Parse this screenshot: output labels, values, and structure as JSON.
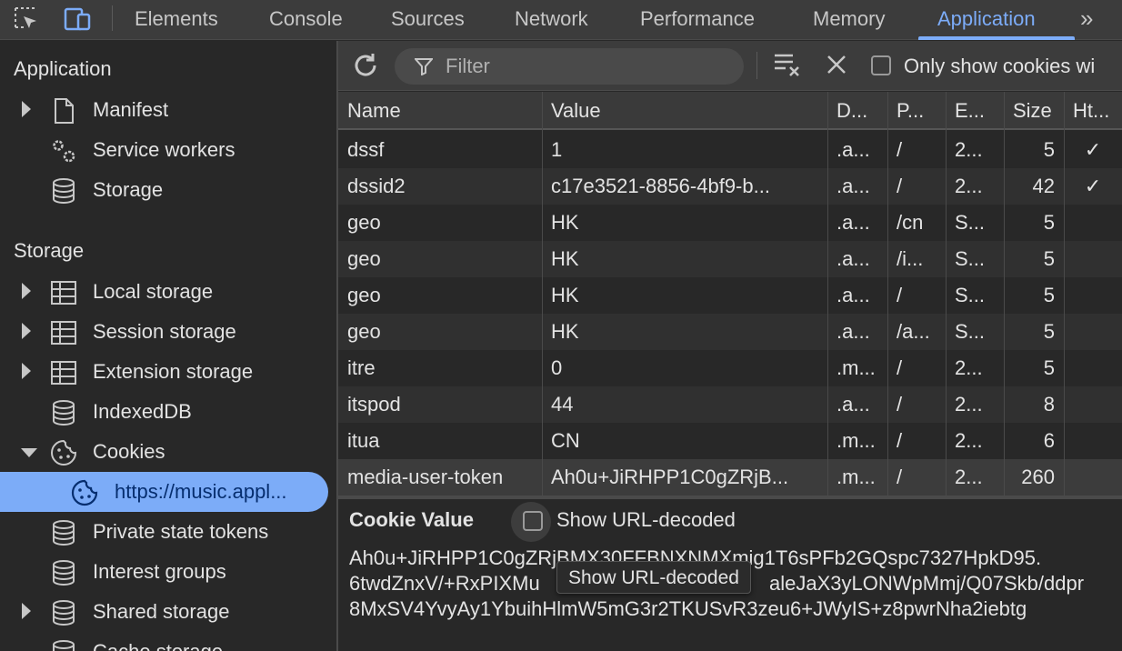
{
  "tabs": [
    {
      "label": "Elements",
      "active": false
    },
    {
      "label": "Console",
      "active": false
    },
    {
      "label": "Sources",
      "active": false
    },
    {
      "label": "Network",
      "active": false
    },
    {
      "label": "Performance",
      "active": false
    },
    {
      "label": "Memory",
      "active": false
    },
    {
      "label": "Application",
      "active": true
    }
  ],
  "sidebar": {
    "application_header": "Application",
    "application_items": [
      {
        "label": "Manifest",
        "icon": "document-icon",
        "expandable": true
      },
      {
        "label": "Service workers",
        "icon": "gears-icon",
        "expandable": false
      },
      {
        "label": "Storage",
        "icon": "database-icon",
        "expandable": false
      }
    ],
    "storage_header": "Storage",
    "storage_items": [
      {
        "label": "Local storage",
        "icon": "table-icon",
        "expandable": true
      },
      {
        "label": "Session storage",
        "icon": "table-icon",
        "expandable": true
      },
      {
        "label": "Extension storage",
        "icon": "table-icon",
        "expandable": true
      },
      {
        "label": "IndexedDB",
        "icon": "database-icon",
        "expandable": false
      },
      {
        "label": "Cookies",
        "icon": "cookie-icon",
        "expanded": true
      },
      {
        "label": "https://music.appl...",
        "icon": "cookie-icon",
        "selected": true
      },
      {
        "label": "Private state tokens",
        "icon": "database-icon",
        "expandable": false
      },
      {
        "label": "Interest groups",
        "icon": "database-icon",
        "expandable": false
      },
      {
        "label": "Shared storage",
        "icon": "database-icon",
        "expandable": true
      },
      {
        "label": "Cache storage",
        "icon": "database-icon",
        "expandable": false
      }
    ]
  },
  "toolbar": {
    "filter_placeholder": "Filter",
    "only_show_label": "Only show cookies wi"
  },
  "table": {
    "headers": [
      "Name",
      "Value",
      "D...",
      "P...",
      "E...",
      "Size",
      "Ht..."
    ],
    "rows": [
      [
        "dssf",
        "1",
        ".a...",
        "/",
        "2...",
        "5",
        "✓"
      ],
      [
        "dssid2",
        "c17e3521-8856-4bf9-b...",
        ".a...",
        "/",
        "2...",
        "42",
        "✓"
      ],
      [
        "geo",
        "HK",
        ".a...",
        "/cn",
        "S...",
        "5",
        ""
      ],
      [
        "geo",
        "HK",
        ".a...",
        "/i...",
        "S...",
        "5",
        ""
      ],
      [
        "geo",
        "HK",
        ".a...",
        "/",
        "S...",
        "5",
        ""
      ],
      [
        "geo",
        "HK",
        ".a...",
        "/a...",
        "S...",
        "5",
        ""
      ],
      [
        "itre",
        "0",
        ".m...",
        "/",
        "2...",
        "5",
        ""
      ],
      [
        "itspod",
        "44",
        ".a...",
        "/",
        "2...",
        "8",
        ""
      ],
      [
        "itua",
        "CN",
        ".m...",
        "/",
        "2...",
        "6",
        ""
      ],
      [
        "media-user-token",
        "Ah0u+JiRHPP1C0gZRjB...",
        ".m...",
        "/",
        "2...",
        "260",
        ""
      ]
    ]
  },
  "cookie_value": {
    "title": "Cookie Value",
    "checkbox_label": "Show URL-decoded",
    "tooltip": "Show URL-decoded",
    "lines": [
      "Ah0u+JiRHPP1C0gZRjBMX30FFBNXNMXmig1T6sPFb2GQspc7327HpkD95.",
      "6twdZnxV/+RxPIXMu",
      "aleJaX3yLONWpMmj/Q07Skb/ddpr",
      "8MxSV4YvyAy1YbuihHlmW5mG3r2TKUSvR3zeu6+JWyIS+z8pwrNha2iebtg"
    ]
  },
  "colors": {
    "accent": "#7cacf8",
    "background": "#282828",
    "toolbar": "#3c3c3c"
  }
}
